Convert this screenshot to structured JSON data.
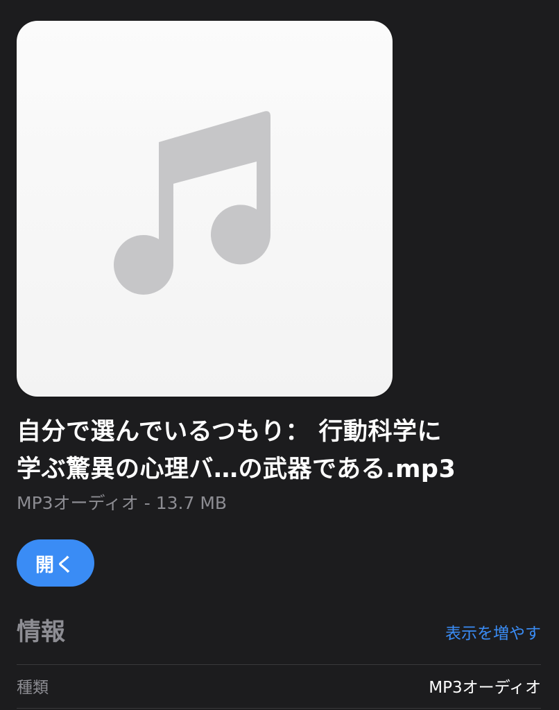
{
  "file": {
    "title_line1": "自分で選んでいるつもり： 行動科学に",
    "title_line2": "学ぶ驚異の心理バ…の武器である.mp3",
    "subtitle": "MP3オーディオ - 13.7 MB",
    "artwork_icon": "music-note-icon"
  },
  "actions": {
    "open_label": "開く"
  },
  "info": {
    "header": "情報",
    "show_more_label": "表示を増やす",
    "rows": [
      {
        "label": "種類",
        "value": "MP3オーディオ"
      }
    ]
  },
  "colors": {
    "background": "#1c1c1e",
    "accent": "#3a8cf5",
    "secondary_text": "#8d8d93",
    "artwork_bg": "#f6f6f6",
    "icon_gray": "#c7c7cc"
  }
}
